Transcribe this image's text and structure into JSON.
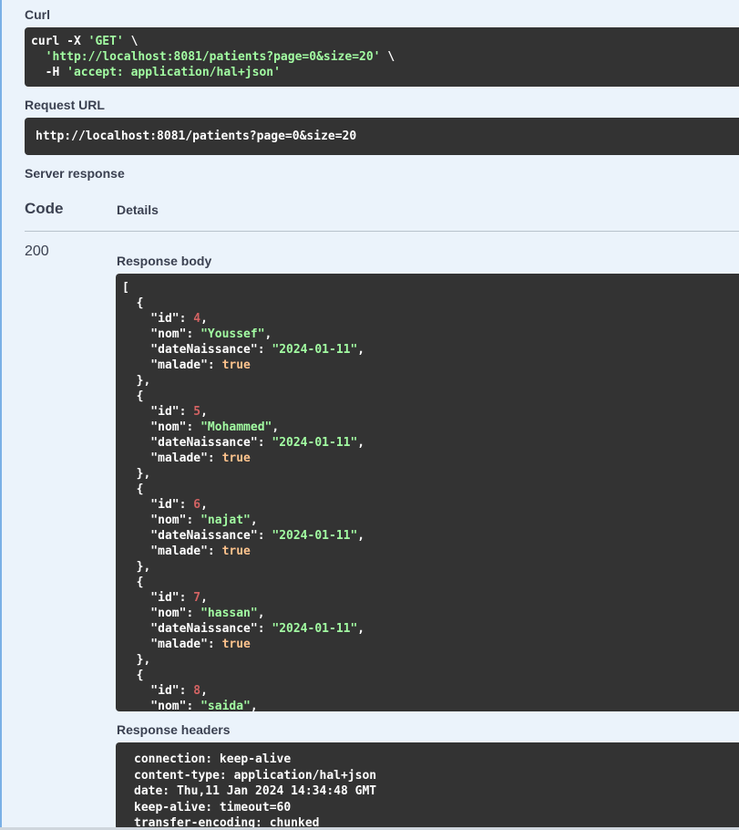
{
  "curl": {
    "label": "Curl",
    "lines": [
      [
        {
          "t": "curl -X ",
          "c": "plain"
        },
        {
          "t": "'GET'",
          "c": "str"
        },
        {
          "t": " \\",
          "c": "plain"
        }
      ],
      [
        {
          "t": "  ",
          "c": "plain"
        },
        {
          "t": "'http://localhost:8081/patients?page=0&size=20'",
          "c": "str"
        },
        {
          "t": " \\",
          "c": "plain"
        }
      ],
      [
        {
          "t": "  -H ",
          "c": "plain"
        },
        {
          "t": "'accept: application/hal+json'",
          "c": "str"
        }
      ]
    ]
  },
  "request_url": {
    "label": "Request URL",
    "value": "http://localhost:8081/patients?page=0&size=20"
  },
  "server_response": {
    "label": "Server response",
    "code_header": "Code",
    "details_header": "Details",
    "code": "200",
    "body_label": "Response body",
    "body_lines": [
      [
        {
          "t": "[",
          "c": "plain"
        }
      ],
      [
        {
          "t": "  {",
          "c": "plain"
        }
      ],
      [
        {
          "t": "    \"id\": ",
          "c": "plain"
        },
        {
          "t": "4",
          "c": "num"
        },
        {
          "t": ",",
          "c": "plain"
        }
      ],
      [
        {
          "t": "    \"nom\": ",
          "c": "plain"
        },
        {
          "t": "\"Youssef\"",
          "c": "str"
        },
        {
          "t": ",",
          "c": "plain"
        }
      ],
      [
        {
          "t": "    \"dateNaissance\": ",
          "c": "plain"
        },
        {
          "t": "\"2024-01-11\"",
          "c": "str"
        },
        {
          "t": ",",
          "c": "plain"
        }
      ],
      [
        {
          "t": "    \"malade\": ",
          "c": "plain"
        },
        {
          "t": "true",
          "c": "bool"
        }
      ],
      [
        {
          "t": "  },",
          "c": "plain"
        }
      ],
      [
        {
          "t": "  {",
          "c": "plain"
        }
      ],
      [
        {
          "t": "    \"id\": ",
          "c": "plain"
        },
        {
          "t": "5",
          "c": "num"
        },
        {
          "t": ",",
          "c": "plain"
        }
      ],
      [
        {
          "t": "    \"nom\": ",
          "c": "plain"
        },
        {
          "t": "\"Mohammed\"",
          "c": "str"
        },
        {
          "t": ",",
          "c": "plain"
        }
      ],
      [
        {
          "t": "    \"dateNaissance\": ",
          "c": "plain"
        },
        {
          "t": "\"2024-01-11\"",
          "c": "str"
        },
        {
          "t": ",",
          "c": "plain"
        }
      ],
      [
        {
          "t": "    \"malade\": ",
          "c": "plain"
        },
        {
          "t": "true",
          "c": "bool"
        }
      ],
      [
        {
          "t": "  },",
          "c": "plain"
        }
      ],
      [
        {
          "t": "  {",
          "c": "plain"
        }
      ],
      [
        {
          "t": "    \"id\": ",
          "c": "plain"
        },
        {
          "t": "6",
          "c": "num"
        },
        {
          "t": ",",
          "c": "plain"
        }
      ],
      [
        {
          "t": "    \"nom\": ",
          "c": "plain"
        },
        {
          "t": "\"najat\"",
          "c": "str"
        },
        {
          "t": ",",
          "c": "plain"
        }
      ],
      [
        {
          "t": "    \"dateNaissance\": ",
          "c": "plain"
        },
        {
          "t": "\"2024-01-11\"",
          "c": "str"
        },
        {
          "t": ",",
          "c": "plain"
        }
      ],
      [
        {
          "t": "    \"malade\": ",
          "c": "plain"
        },
        {
          "t": "true",
          "c": "bool"
        }
      ],
      [
        {
          "t": "  },",
          "c": "plain"
        }
      ],
      [
        {
          "t": "  {",
          "c": "plain"
        }
      ],
      [
        {
          "t": "    \"id\": ",
          "c": "plain"
        },
        {
          "t": "7",
          "c": "num"
        },
        {
          "t": ",",
          "c": "plain"
        }
      ],
      [
        {
          "t": "    \"nom\": ",
          "c": "plain"
        },
        {
          "t": "\"hassan\"",
          "c": "str"
        },
        {
          "t": ",",
          "c": "plain"
        }
      ],
      [
        {
          "t": "    \"dateNaissance\": ",
          "c": "plain"
        },
        {
          "t": "\"2024-01-11\"",
          "c": "str"
        },
        {
          "t": ",",
          "c": "plain"
        }
      ],
      [
        {
          "t": "    \"malade\": ",
          "c": "plain"
        },
        {
          "t": "true",
          "c": "bool"
        }
      ],
      [
        {
          "t": "  },",
          "c": "plain"
        }
      ],
      [
        {
          "t": "  {",
          "c": "plain"
        }
      ],
      [
        {
          "t": "    \"id\": ",
          "c": "plain"
        },
        {
          "t": "8",
          "c": "num"
        },
        {
          "t": ",",
          "c": "plain"
        }
      ],
      [
        {
          "t": "    \"nom\": ",
          "c": "plain"
        },
        {
          "t": "\"saida\"",
          "c": "str"
        },
        {
          "t": ",",
          "c": "plain"
        }
      ]
    ],
    "headers_label": "Response headers",
    "header_lines": [
      "connection: keep-alive",
      "content-type: application/hal+json",
      "date: Thu,11 Jan 2024 14:34:48 GMT",
      "keep-alive: timeout=60",
      "transfer-encoding: chunked"
    ]
  },
  "colors": {
    "background": "#ebf3fb",
    "code_block": "#333333",
    "string": "#a2fca2",
    "number": "#d36363",
    "boolean": "#fcc28c"
  }
}
